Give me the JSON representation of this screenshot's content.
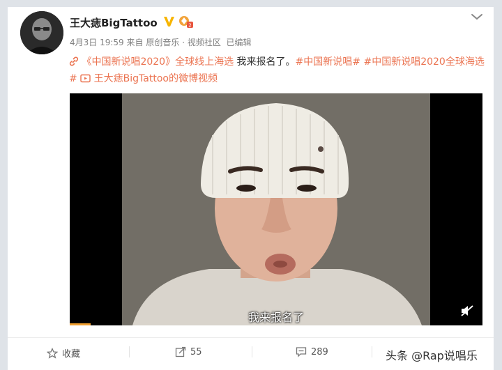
{
  "post": {
    "username": "王大痣BigTattoo",
    "verified_icon": "verified-v-icon",
    "medal_icon": "fan-medal-icon",
    "meta": {
      "date": "4月3日",
      "time": "19:59",
      "from_prefix": "来自",
      "source": "原创音乐",
      "category": "· 视频社区",
      "edited": "已编辑"
    },
    "text": {
      "topic_link": "《中国新说唱2020》全球线上海选",
      "body": " 我来报名了。",
      "hashtag1": "#中国新说唱#",
      "hashtag2": "#中国新说唱2020全球海选#",
      "video_link": "王大痣BigTattoo的微博视频"
    },
    "video": {
      "subtitle": "我来报名了",
      "progress_fraction": 0.05
    }
  },
  "footer": {
    "favorite_label": "收藏",
    "share_count": "55",
    "comment_count": "289",
    "watermark": "头条 @Rap说唱乐"
  },
  "colors": {
    "link": "#eb7350",
    "accent_verified": "#f7b500",
    "card_bg": "#ffffff",
    "page_bg": "#dfe3e8"
  }
}
